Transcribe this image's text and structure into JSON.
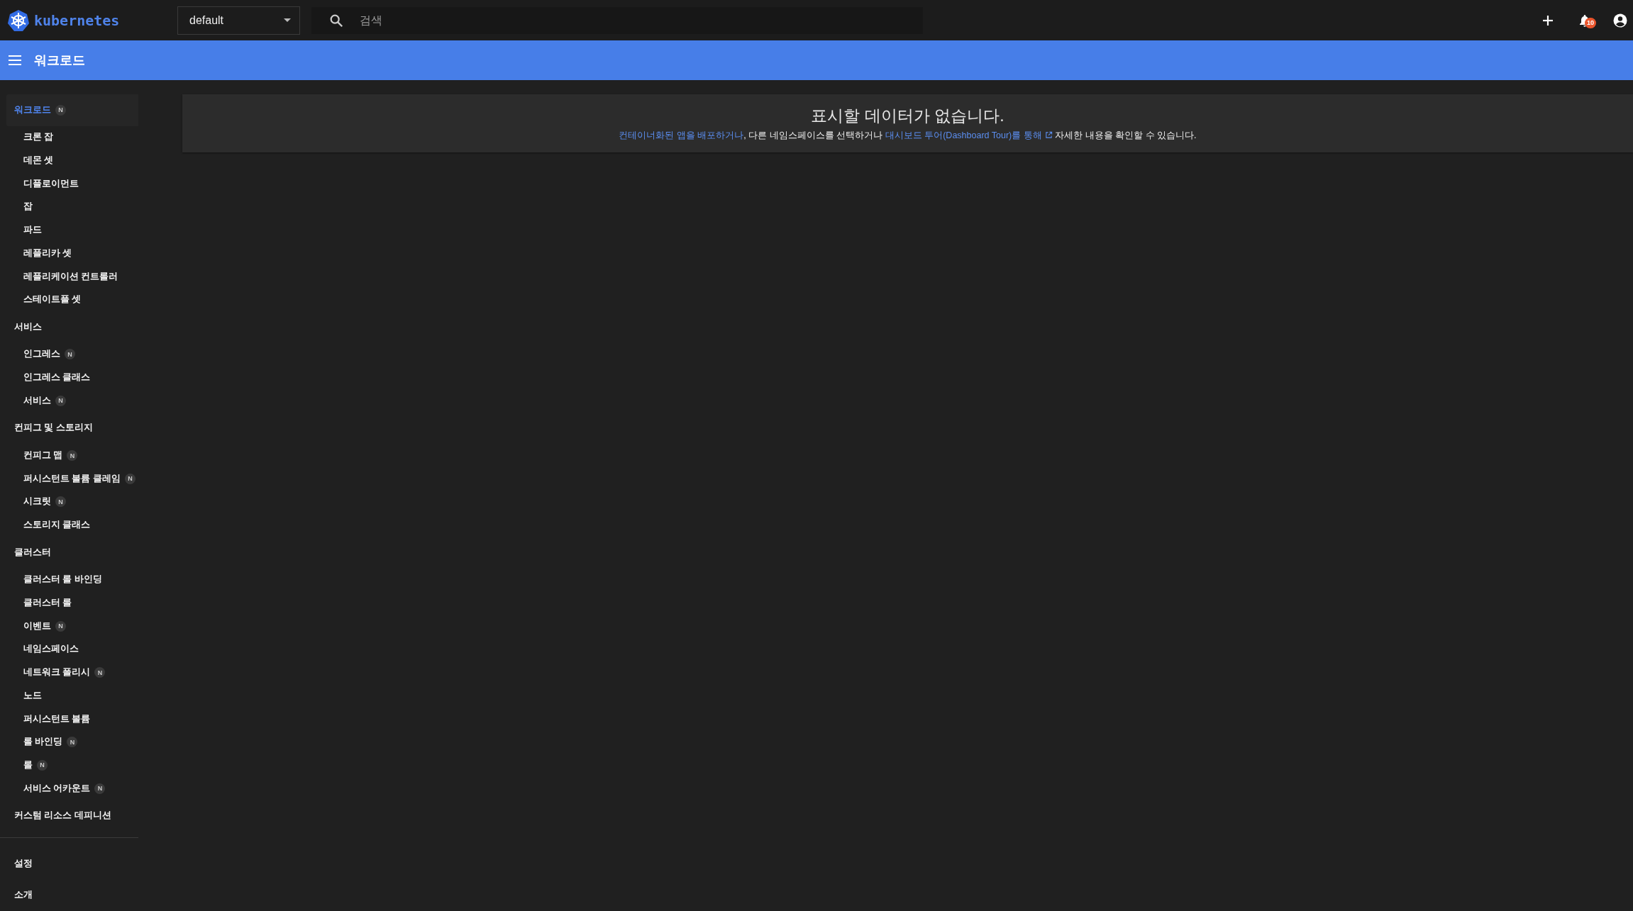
{
  "header": {
    "logo_text": "kubernetes",
    "namespace": {
      "value": "default"
    },
    "search": {
      "placeholder": "검색"
    },
    "notifications": {
      "count": "10"
    }
  },
  "toolbar": {
    "title": "워크로드"
  },
  "sidebar": {
    "sections": [
      {
        "title": "워크로드",
        "selected": true,
        "badge": "N",
        "children": [
          {
            "label": "크론 잡",
            "selected": false
          },
          {
            "label": "데몬 셋",
            "selected": false
          },
          {
            "label": "디플로이먼트",
            "selected": false
          },
          {
            "label": "잡",
            "selected": false
          },
          {
            "label": "파드",
            "selected": false
          },
          {
            "label": "레플리카 셋",
            "selected": false
          },
          {
            "label": "레플리케이션 컨트롤러",
            "selected": false
          },
          {
            "label": "스테이트풀 셋",
            "selected": false
          }
        ]
      },
      {
        "title": "서비스",
        "selected": false,
        "children": [
          {
            "label": "인그레스",
            "selected": false,
            "badge": "N"
          },
          {
            "label": "인그레스 클래스",
            "selected": false
          },
          {
            "label": "서비스",
            "selected": false,
            "badge": "N"
          }
        ]
      },
      {
        "title": "컨피그 및 스토리지",
        "selected": false,
        "children": [
          {
            "label": "컨피그 맵",
            "selected": false,
            "badge": "N"
          },
          {
            "label": "퍼시스턴트 볼륨 클레임",
            "selected": false,
            "badge": "N"
          },
          {
            "label": "시크릿",
            "selected": false,
            "badge": "N"
          },
          {
            "label": "스토리지 클래스",
            "selected": false
          }
        ]
      },
      {
        "title": "클러스터",
        "selected": false,
        "children": [
          {
            "label": "클러스터 롤 바인딩",
            "selected": false
          },
          {
            "label": "클러스터 롤",
            "selected": false
          },
          {
            "label": "이벤트",
            "selected": false,
            "badge": "N"
          },
          {
            "label": "네임스페이스",
            "selected": false
          },
          {
            "label": "네트워크 폴리시",
            "selected": false,
            "badge": "N"
          },
          {
            "label": "노드",
            "selected": false
          },
          {
            "label": "퍼시스턴트 볼륨",
            "selected": false
          },
          {
            "label": "롤 바인딩",
            "selected": false,
            "badge": "N"
          },
          {
            "label": "롤",
            "selected": false,
            "badge": "N"
          },
          {
            "label": "서비스 어카운트",
            "selected": false,
            "badge": "N"
          }
        ]
      },
      {
        "title": "커스텀 리소스 데피니션",
        "selected": false
      }
    ],
    "footer_items": [
      {
        "label": "설정",
        "selected": false
      },
      {
        "label": "소개",
        "selected": false
      }
    ]
  },
  "empty_state": {
    "title": "표시할 데이터가 없습니다.",
    "message": [
      {
        "kind": "link",
        "text": "컨테이너화된 앱을 배포하거나"
      },
      {
        "kind": "text",
        "text": ", 다른 네임스페이스를 선택하거나 "
      },
      {
        "kind": "external_link",
        "text": "대시보드 투어(Dashboard Tour)를 통해"
      },
      {
        "kind": "text",
        "text": " 자세한 내용을 확인할 수 있습니다."
      }
    ]
  }
}
